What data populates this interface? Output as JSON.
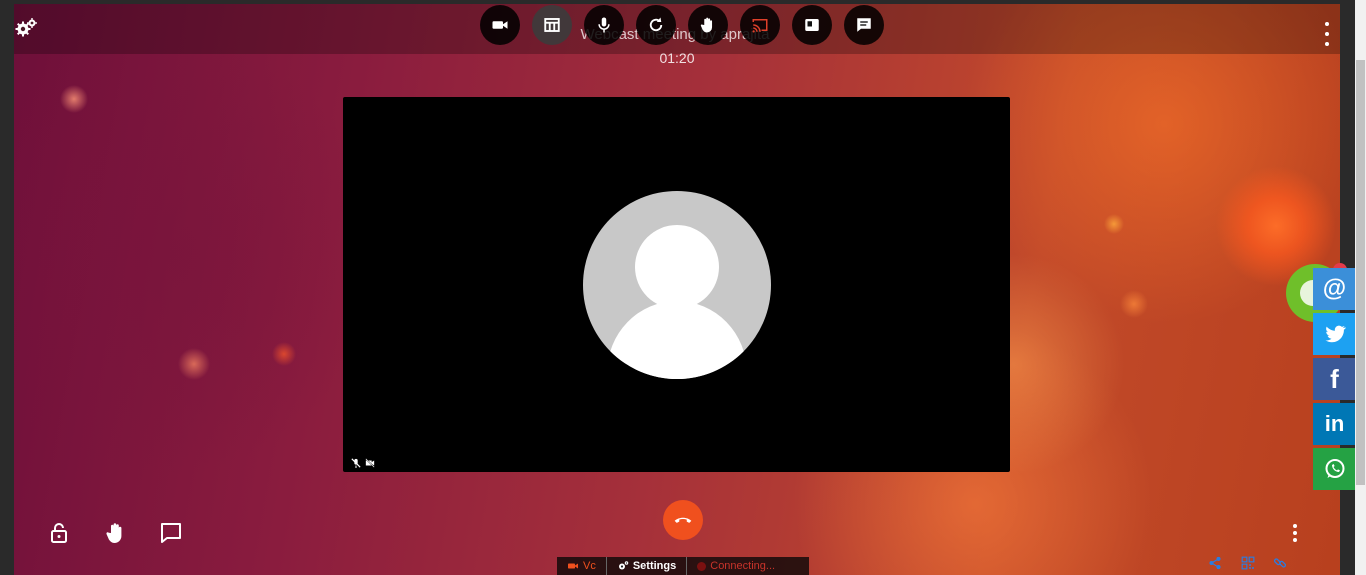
{
  "meeting": {
    "title": "Webcast meeting by aprajita",
    "timer": "01:20"
  },
  "toolbar": {
    "buttons": [
      {
        "icon": "video-camera-icon"
      },
      {
        "icon": "layout-icon"
      },
      {
        "icon": "microphone-icon"
      },
      {
        "icon": "refresh-icon"
      },
      {
        "icon": "raise-hand-icon"
      },
      {
        "icon": "cast-icon"
      },
      {
        "icon": "screen-share-icon"
      },
      {
        "icon": "chat-icon"
      }
    ]
  },
  "status_bar": {
    "vc_label": "Vc",
    "settings_label": "Settings",
    "connection_label": "Connecting..."
  },
  "share_panel": [
    {
      "icon": "email-icon",
      "label": "@",
      "color": "#3b8fd9"
    },
    {
      "icon": "twitter-icon",
      "color": "#1da1f2"
    },
    {
      "icon": "facebook-icon",
      "label": "f",
      "color": "#3b5998"
    },
    {
      "icon": "linkedin-icon",
      "label": "in",
      "color": "#0077b5"
    },
    {
      "icon": "whatsapp-icon",
      "color": "#25a244"
    }
  ],
  "colors": {
    "hangup": "#f0501e",
    "chat_widget": "#6fbf2a",
    "badge": "#e33b4a"
  }
}
